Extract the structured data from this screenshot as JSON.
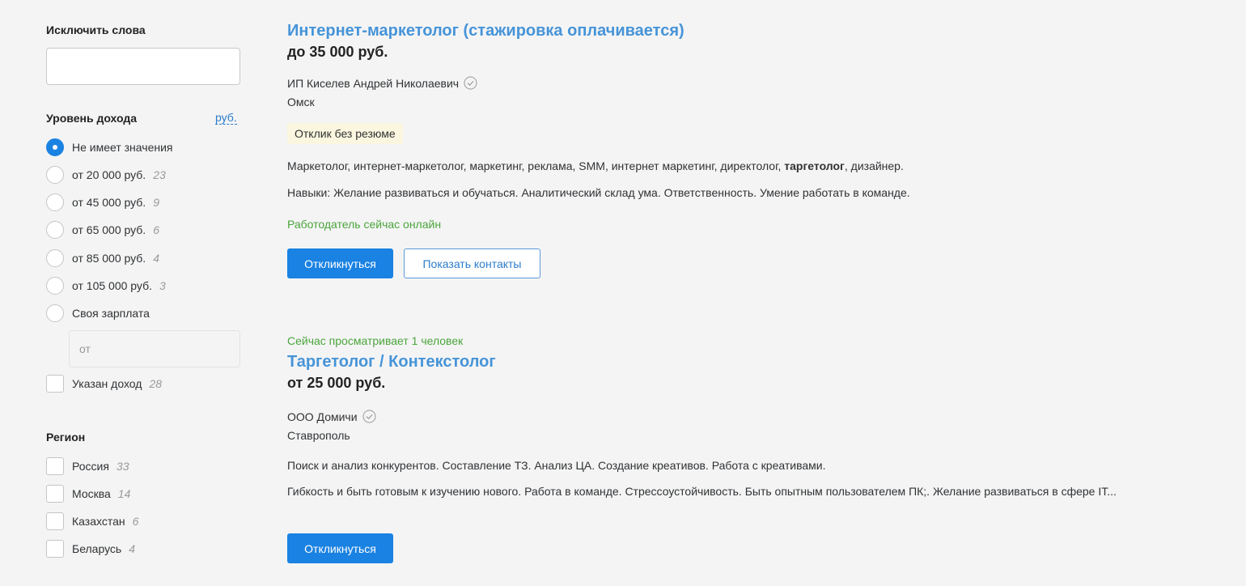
{
  "filters": {
    "exclude_words": {
      "title": "Исключить слова",
      "value": ""
    },
    "income": {
      "title": "Уровень дохода",
      "currency_link": "руб.",
      "options": [
        {
          "label": "Не имеет значения",
          "count": "",
          "checked": true
        },
        {
          "label": "от 20 000 руб.",
          "count": "23",
          "checked": false
        },
        {
          "label": "от 45 000 руб.",
          "count": "9",
          "checked": false
        },
        {
          "label": "от 65 000 руб.",
          "count": "6",
          "checked": false
        },
        {
          "label": "от 85 000 руб.",
          "count": "4",
          "checked": false
        },
        {
          "label": "от 105 000 руб.",
          "count": "3",
          "checked": false
        },
        {
          "label": "Своя зарплата",
          "count": "",
          "checked": false
        }
      ],
      "custom_salary_placeholder": "от",
      "income_specified": {
        "label": "Указан доход",
        "count": "28",
        "checked": false
      }
    },
    "region": {
      "title": "Регион",
      "options": [
        {
          "label": "Россия",
          "count": "33",
          "checked": false
        },
        {
          "label": "Москва",
          "count": "14",
          "checked": false
        },
        {
          "label": "Казахстан",
          "count": "6",
          "checked": false
        },
        {
          "label": "Беларусь",
          "count": "4",
          "checked": false
        }
      ]
    }
  },
  "vacancies": [
    {
      "viewing": "",
      "title": "Интернет-маркетолог (стажировка оплачивается)",
      "salary": "до 35 000 руб.",
      "employer": "ИП Киселев Андрей Николаевич",
      "city": "Омск",
      "badge": "Отклик без резюме",
      "responsibility_before": "Маркетолог, интернет-маркетолог, маркетинг, реклама, SMM, интернет маркетинг, директолог, ",
      "responsibility_highlight": "таргетолог",
      "responsibility_after": ", дизайнер.",
      "requirement": "Навыки: Желание развиваться и обучаться. Аналитический склад ума. Ответственность. Умение работать в команде.",
      "online": "Работодатель сейчас онлайн",
      "respond_label": "Откликнуться",
      "contacts_label": "Показать контакты"
    },
    {
      "viewing": "Сейчас просматривает 1 человек",
      "title": "Таргетолог / Контекстолог",
      "salary": "от 25 000 руб.",
      "employer": "ООО Домичи",
      "city": "Ставрополь",
      "responsibility": "Поиск и анализ конкурентов. Составление ТЗ. Анализ ЦА. Создание креативов. Работа с креативами.",
      "requirement": "Гибкость и быть готовым к изучению нового. Работа в команде. Стрессоустойчивость. Быть опытным пользователем ПК;. Желание развиваться в сфере IT...",
      "respond_label": "Откликнуться"
    }
  ],
  "colors": {
    "accent": "#1a82e2",
    "link": "#4694d8",
    "online": "#4ba53b",
    "badge_bg": "#fbf6df",
    "background": "#f4f4f5"
  },
  "icons": {
    "verified": "check-circle-icon"
  }
}
